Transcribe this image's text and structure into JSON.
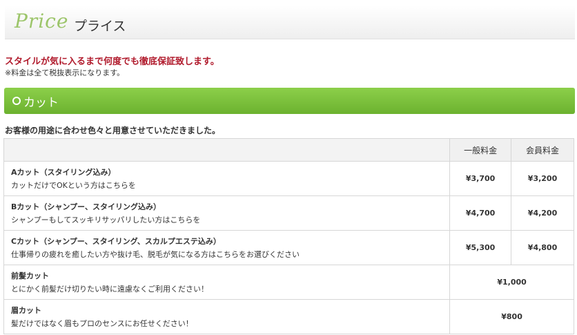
{
  "header": {
    "script_title": "Price",
    "title": "プライス"
  },
  "notice": "スタイルが気に入るまで何度でも徹底保証致します。",
  "tax_note": "※料金は全て税抜表示になります。",
  "section": {
    "title": "カット"
  },
  "section_sub": "お客様の用途に合わせ色々と用意させていただきました。",
  "table": {
    "headers": {
      "regular": "一般料金",
      "member": "会員料金"
    },
    "rows": [
      {
        "name": "Aカット（スタイリング込み）",
        "desc": "カットだけでOKという方はこちらを",
        "regular": "¥3,700",
        "member": "¥3,200"
      },
      {
        "name": "Bカット（シャンプー、スタイリング込み）",
        "desc": "シャンプーもしてスッキリサッパリしたい方はこちらを",
        "regular": "¥4,700",
        "member": "¥4,200"
      },
      {
        "name": "Cカット（シャンプー、スタイリング、スカルプエステ込み）",
        "desc": "仕事帰りの疲れを癒したい方や抜け毛、脱毛が気になる方はこちらをお選びください",
        "regular": "¥5,300",
        "member": "¥4,800"
      },
      {
        "name": "前髪カット",
        "desc": "とにかく前髪だけ切りたい時に遠慮なくご利用ください！",
        "price": "¥1,000"
      },
      {
        "name": "眉カット",
        "desc": "髪だけではなく眉もプロのセンスにお任せください！",
        "price": "¥800"
      }
    ]
  }
}
